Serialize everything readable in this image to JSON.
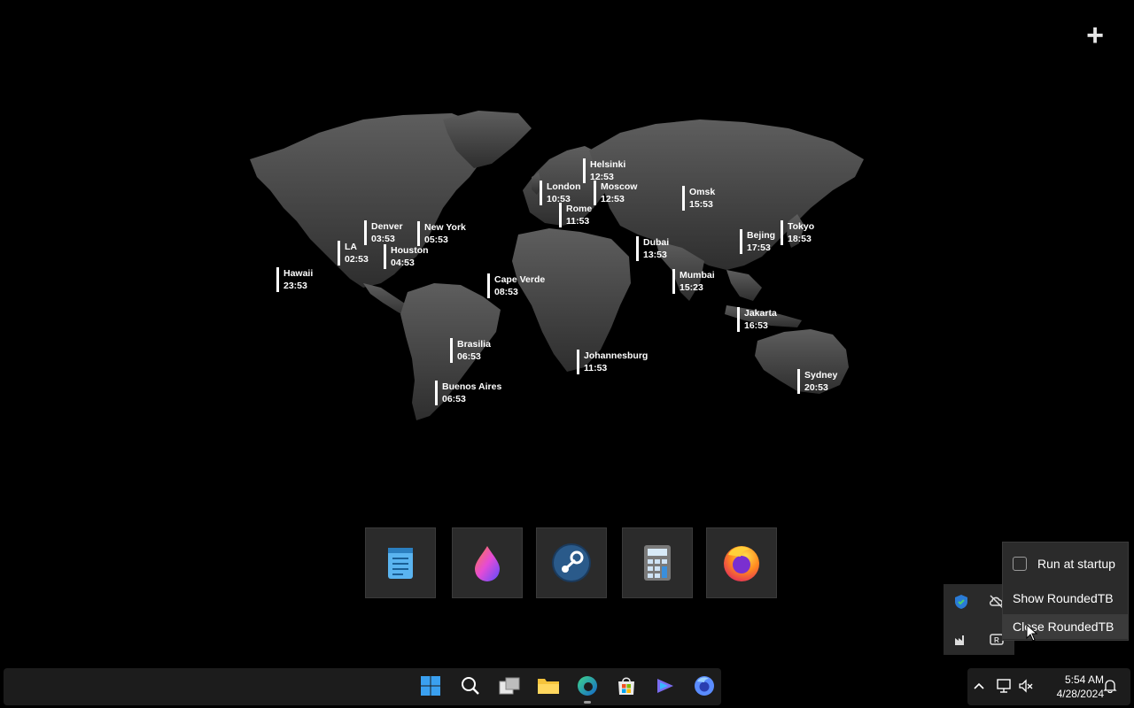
{
  "corner_button": {
    "label": "+"
  },
  "cities": [
    {
      "name": "Hawaii",
      "time": "23:53"
    },
    {
      "name": "LA",
      "time": "02:53"
    },
    {
      "name": "Denver",
      "time": "03:53"
    },
    {
      "name": "Houston",
      "time": "04:53"
    },
    {
      "name": "New York",
      "time": "05:53"
    },
    {
      "name": "Cape Verde",
      "time": "08:53"
    },
    {
      "name": "Brasilia",
      "time": "06:53"
    },
    {
      "name": "Buenos Aires",
      "time": "06:53"
    },
    {
      "name": "London",
      "time": "10:53"
    },
    {
      "name": "Helsinki",
      "time": "12:53"
    },
    {
      "name": "Moscow",
      "time": "12:53"
    },
    {
      "name": "Rome",
      "time": "11:53"
    },
    {
      "name": "Johannesburg",
      "time": "11:53"
    },
    {
      "name": "Dubai",
      "time": "13:53"
    },
    {
      "name": "Omsk",
      "time": "15:53"
    },
    {
      "name": "Mumbai",
      "time": "15:23"
    },
    {
      "name": "Bejing",
      "time": "17:53"
    },
    {
      "name": "Tokyo",
      "time": "18:53"
    },
    {
      "name": "Jakarta",
      "time": "16:53"
    },
    {
      "name": "Sydney",
      "time": "20:53"
    }
  ],
  "dock": [
    {
      "icon": "notepad-icon"
    },
    {
      "icon": "drop-app-icon"
    },
    {
      "icon": "steam-icon"
    },
    {
      "icon": "calculator-icon"
    },
    {
      "icon": "firefox-icon"
    }
  ],
  "context_menu": {
    "run_at_startup": "Run at startup",
    "run_at_startup_checked": false,
    "show": "Show RoundedTB",
    "close": "Close RoundedTB"
  },
  "taskbar": {
    "apps": [
      "start-icon",
      "search-icon",
      "task-view-icon",
      "file-explorer-icon",
      "edge-icon",
      "store-icon",
      "copilot-icon",
      "firefox-icon"
    ],
    "tray": [
      "chevron-up-icon",
      "network-icon",
      "speaker-muted-icon",
      "notification-icon"
    ],
    "clock_time": "5:54 AM",
    "clock_date": "4/28/2024"
  },
  "colors": {
    "map_land": "#4a4a4a",
    "accent_blue": "#0078d4",
    "menu_bg": "#2b2b2b"
  }
}
